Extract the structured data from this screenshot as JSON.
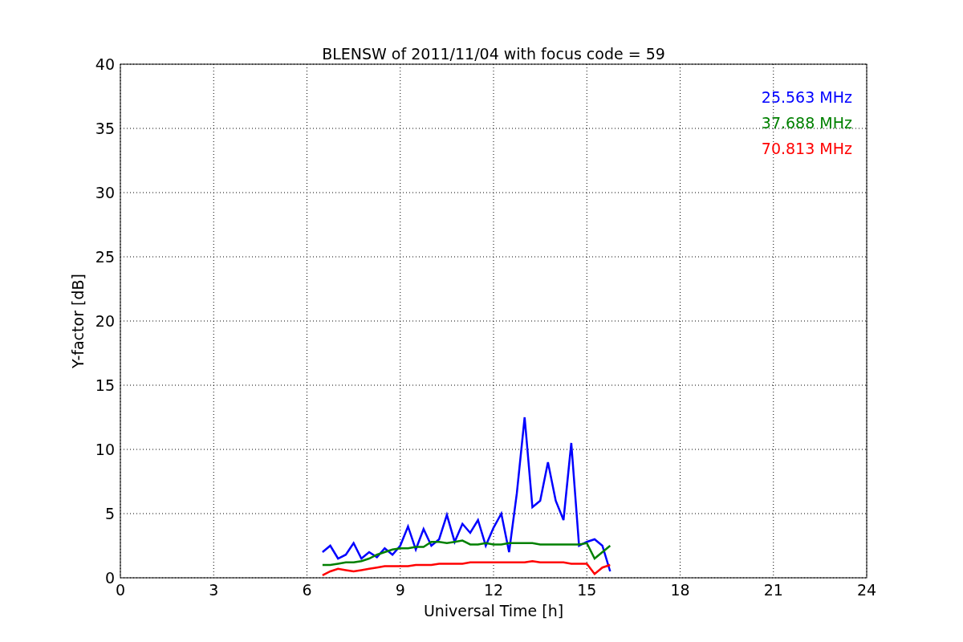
{
  "chart_data": {
    "type": "line",
    "title": "BLENSW of 2011/11/04 with focus code = 59",
    "xlabel": "Universal Time [h]",
    "ylabel": "Y-factor [dB]",
    "x": [
      6.5,
      6.75,
      7,
      7.25,
      7.5,
      7.75,
      8,
      8.25,
      8.5,
      8.75,
      9,
      9.25,
      9.5,
      9.75,
      10,
      10.25,
      10.5,
      10.75,
      11,
      11.25,
      11.5,
      11.75,
      12,
      12.25,
      12.5,
      12.75,
      13,
      13.25,
      13.5,
      13.75,
      14,
      14.25,
      14.5,
      14.75,
      15,
      15.25,
      15.5,
      15.75
    ],
    "series": [
      {
        "name": "25.563 MHz",
        "color": "#0000ff",
        "values": [
          2.0,
          2.5,
          1.5,
          1.8,
          2.7,
          1.5,
          2.0,
          1.6,
          2.3,
          1.8,
          2.5,
          4.0,
          2.2,
          3.8,
          2.5,
          3.0,
          4.9,
          2.8,
          4.2,
          3.5,
          4.5,
          2.5,
          3.9,
          5.0,
          2.0,
          6.6,
          12.5,
          5.5,
          6.0,
          9.0,
          6.0,
          4.5,
          10.5,
          2.5,
          2.8,
          3.0,
          2.5,
          0.5
        ]
      },
      {
        "name": "37.688 MHz",
        "color": "#008000",
        "values": [
          1.0,
          1.0,
          1.1,
          1.2,
          1.2,
          1.3,
          1.5,
          1.8,
          2.0,
          2.2,
          2.3,
          2.3,
          2.4,
          2.4,
          2.8,
          2.8,
          2.7,
          2.8,
          2.9,
          2.6,
          2.6,
          2.7,
          2.6,
          2.6,
          2.7,
          2.7,
          2.7,
          2.7,
          2.6,
          2.6,
          2.6,
          2.6,
          2.6,
          2.6,
          2.7,
          1.5,
          2.0,
          2.5
        ]
      },
      {
        "name": "70.813 MHz",
        "color": "#ff0000",
        "values": [
          0.2,
          0.5,
          0.7,
          0.6,
          0.5,
          0.6,
          0.7,
          0.8,
          0.9,
          0.9,
          0.9,
          0.9,
          1.0,
          1.0,
          1.0,
          1.1,
          1.1,
          1.1,
          1.1,
          1.2,
          1.2,
          1.2,
          1.2,
          1.2,
          1.2,
          1.2,
          1.2,
          1.3,
          1.2,
          1.2,
          1.2,
          1.2,
          1.1,
          1.1,
          1.1,
          0.3,
          0.8,
          1.0
        ]
      }
    ],
    "xlim": [
      0,
      24
    ],
    "ylim": [
      0,
      40
    ],
    "xticks": [
      0,
      3,
      6,
      9,
      12,
      15,
      18,
      21,
      24
    ],
    "yticks": [
      0,
      5,
      10,
      15,
      20,
      25,
      30,
      35,
      40
    ],
    "grid": true
  }
}
